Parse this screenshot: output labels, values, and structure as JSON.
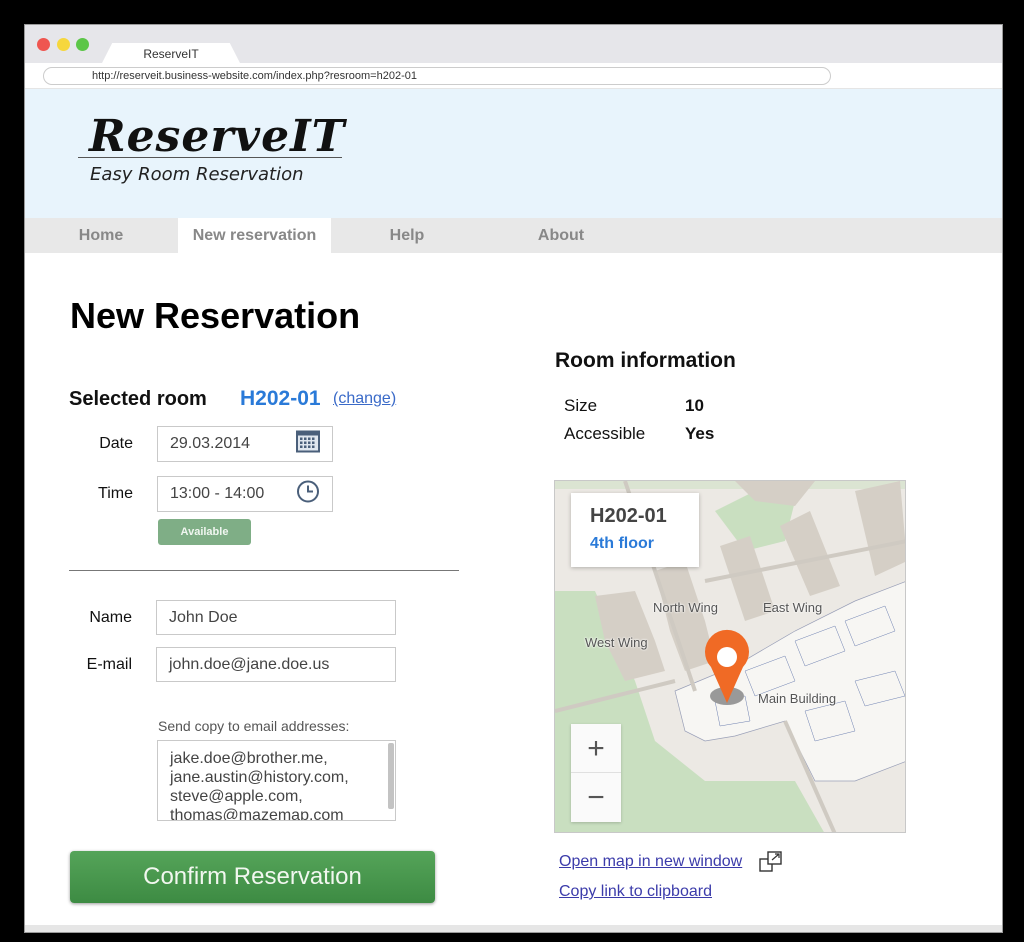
{
  "browser": {
    "tab_title": "ReserveIT",
    "url": "http://reserveit.business-website.com/index.php?resroom=h202-01"
  },
  "header": {
    "logo": "ReserveIT",
    "tagline": "Easy Room Reservation"
  },
  "nav": {
    "items": [
      {
        "label": "Home",
        "active": false
      },
      {
        "label": "New reservation",
        "active": true
      },
      {
        "label": "Help",
        "active": false
      },
      {
        "label": "About",
        "active": false
      }
    ]
  },
  "page": {
    "title": "New Reservation"
  },
  "form": {
    "selected_room_label": "Selected room",
    "selected_room": "H202-01",
    "change_link": "(change)",
    "date_label": "Date",
    "date_value": "29.03.2014",
    "time_label": "Time",
    "time_value": "13:00 - 14:00",
    "availability": "Available",
    "name_label": "Name",
    "name_value": "John Doe",
    "email_label": "E-mail",
    "email_value": "john.doe@jane.doe.us",
    "copy_label": "Send copy to email addresses:",
    "copy_emails": [
      "jake.doe@brother.me,",
      "jane.austin@history.com,",
      "steve@apple.com,",
      "thomas@mazemap.com"
    ],
    "confirm_button": "Confirm Reservation"
  },
  "room_info": {
    "title": "Room information",
    "rows": [
      {
        "label": "Size",
        "value": "10"
      },
      {
        "label": "Accessible",
        "value": "Yes"
      }
    ]
  },
  "map": {
    "room": "H202-01",
    "floor": "4th floor",
    "labels": [
      "North Wing",
      "East Wing",
      "West Wing",
      "Main Building"
    ],
    "zoom_in": "+",
    "zoom_out": "−",
    "colors": {
      "pin": "#f06a25",
      "building": "#d5cfc6",
      "grass": "#c9dfc0"
    }
  },
  "links": {
    "open_map": "Open map in new window",
    "copy_link": "Copy link to clipboard"
  }
}
